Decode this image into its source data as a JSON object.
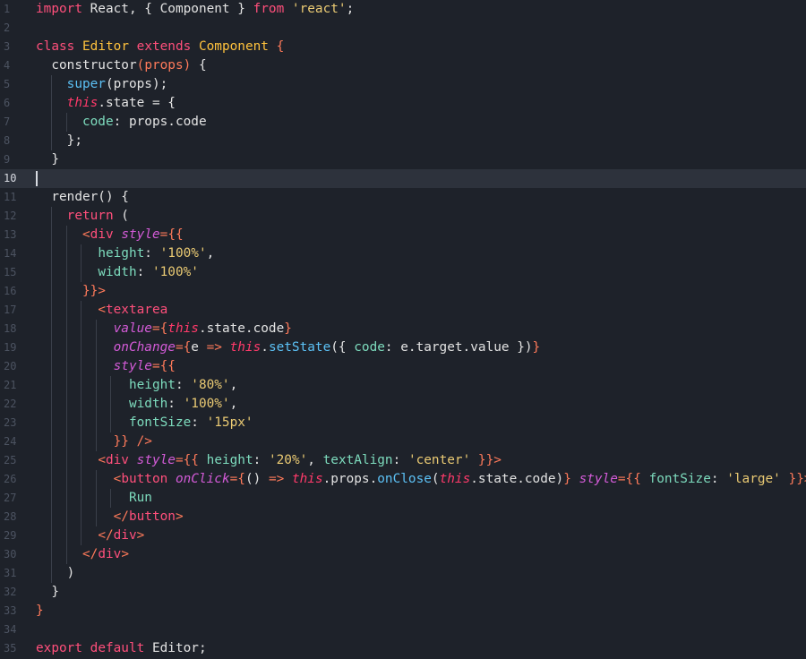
{
  "editor": {
    "current_line": 10,
    "colors": {
      "background": "#1e222a",
      "current_line_bg": "#2d323c",
      "gutter": "#4c5361",
      "text": "#e2e2e2",
      "keyword": "#ff4f7b",
      "class_name": "#ffc23d",
      "string": "#eaca73",
      "punctuation": "#ff7a5a",
      "function": "#5cc1f5",
      "property": "#7ddbbd",
      "jsx_attribute": "#d35bd7",
      "this_keyword": "#ff3a6a"
    }
  },
  "lines": [
    {
      "n": "1",
      "indent": 0,
      "tokens": [
        [
          "kw",
          "import"
        ],
        [
          "t",
          " React, { Component } "
        ],
        [
          "kw",
          "from"
        ],
        [
          "t",
          " "
        ],
        [
          "str",
          "'react'"
        ],
        [
          "t",
          ";"
        ]
      ]
    },
    {
      "n": "2",
      "indent": 0,
      "tokens": []
    },
    {
      "n": "3",
      "indent": 0,
      "tokens": [
        [
          "kw",
          "class"
        ],
        [
          "t",
          " "
        ],
        [
          "cls",
          "Editor"
        ],
        [
          "t",
          " "
        ],
        [
          "kw",
          "extends"
        ],
        [
          "t",
          " "
        ],
        [
          "cls",
          "Component"
        ],
        [
          "t",
          " "
        ],
        [
          "pun",
          "{"
        ]
      ]
    },
    {
      "n": "4",
      "indent": 1,
      "tokens": [
        [
          "t",
          "  constructor"
        ],
        [
          "pun",
          "("
        ],
        [
          "pun",
          "props"
        ],
        [
          "pun",
          ")"
        ],
        [
          "t",
          " {"
        ]
      ]
    },
    {
      "n": "5",
      "indent": 2,
      "tokens": [
        [
          "t",
          "    "
        ],
        [
          "fn",
          "super"
        ],
        [
          "t",
          "(props);"
        ]
      ]
    },
    {
      "n": "6",
      "indent": 2,
      "tokens": [
        [
          "t",
          "    "
        ],
        [
          "this",
          "this"
        ],
        [
          "t",
          ".state = {"
        ]
      ]
    },
    {
      "n": "7",
      "indent": 3,
      "tokens": [
        [
          "t",
          "      "
        ],
        [
          "prop",
          "code"
        ],
        [
          "t",
          ": props."
        ],
        [
          "t",
          "code"
        ]
      ]
    },
    {
      "n": "8",
      "indent": 2,
      "tokens": [
        [
          "t",
          "    "
        ],
        [
          "t",
          "};"
        ]
      ]
    },
    {
      "n": "9",
      "indent": 1,
      "tokens": [
        [
          "t",
          "  }"
        ]
      ]
    },
    {
      "n": "10",
      "indent": 0,
      "tokens": []
    },
    {
      "n": "11",
      "indent": 1,
      "tokens": [
        [
          "t",
          "  render() {"
        ]
      ]
    },
    {
      "n": "12",
      "indent": 2,
      "tokens": [
        [
          "t",
          "    "
        ],
        [
          "kw",
          "return"
        ],
        [
          "t",
          " ("
        ]
      ]
    },
    {
      "n": "13",
      "indent": 3,
      "tokens": [
        [
          "t",
          "      "
        ],
        [
          "pun",
          "<"
        ],
        [
          "kw",
          "div"
        ],
        [
          "t",
          " "
        ],
        [
          "attr",
          "style"
        ],
        [
          "pun",
          "={{"
        ]
      ]
    },
    {
      "n": "14",
      "indent": 4,
      "tokens": [
        [
          "t",
          "        "
        ],
        [
          "prop",
          "height"
        ],
        [
          "t",
          ": "
        ],
        [
          "str",
          "'100%'"
        ],
        [
          "t",
          ","
        ]
      ]
    },
    {
      "n": "15",
      "indent": 4,
      "tokens": [
        [
          "t",
          "        "
        ],
        [
          "prop",
          "width"
        ],
        [
          "t",
          ": "
        ],
        [
          "str",
          "'100%'"
        ]
      ]
    },
    {
      "n": "16",
      "indent": 3,
      "tokens": [
        [
          "t",
          "      "
        ],
        [
          "pun",
          "}}>"
        ]
      ]
    },
    {
      "n": "17",
      "indent": 4,
      "tokens": [
        [
          "t",
          "        "
        ],
        [
          "pun",
          "<"
        ],
        [
          "kw",
          "textarea"
        ]
      ]
    },
    {
      "n": "18",
      "indent": 5,
      "tokens": [
        [
          "t",
          "          "
        ],
        [
          "attr",
          "value"
        ],
        [
          "pun",
          "={"
        ],
        [
          "this",
          "this"
        ],
        [
          "t",
          ".state."
        ],
        [
          "t",
          "code"
        ],
        [
          "pun",
          "}"
        ]
      ]
    },
    {
      "n": "19",
      "indent": 5,
      "tokens": [
        [
          "t",
          "          "
        ],
        [
          "attr",
          "onChange"
        ],
        [
          "pun",
          "={"
        ],
        [
          "t",
          "e "
        ],
        [
          "pun",
          "=>"
        ],
        [
          "t",
          " "
        ],
        [
          "this",
          "this"
        ],
        [
          "t",
          "."
        ],
        [
          "fn",
          "setState"
        ],
        [
          "t",
          "({ "
        ],
        [
          "prop",
          "code"
        ],
        [
          "t",
          ": e.target.value })"
        ],
        [
          "pun",
          "}"
        ]
      ]
    },
    {
      "n": "20",
      "indent": 5,
      "tokens": [
        [
          "t",
          "          "
        ],
        [
          "attr",
          "style"
        ],
        [
          "pun",
          "={{"
        ]
      ]
    },
    {
      "n": "21",
      "indent": 6,
      "tokens": [
        [
          "t",
          "            "
        ],
        [
          "prop",
          "height"
        ],
        [
          "t",
          ": "
        ],
        [
          "str",
          "'80%'"
        ],
        [
          "t",
          ","
        ]
      ]
    },
    {
      "n": "22",
      "indent": 6,
      "tokens": [
        [
          "t",
          "            "
        ],
        [
          "prop",
          "width"
        ],
        [
          "t",
          ": "
        ],
        [
          "str",
          "'100%'"
        ],
        [
          "t",
          ","
        ]
      ]
    },
    {
      "n": "23",
      "indent": 6,
      "tokens": [
        [
          "t",
          "            "
        ],
        [
          "prop",
          "fontSize"
        ],
        [
          "t",
          ": "
        ],
        [
          "str",
          "'15px'"
        ]
      ]
    },
    {
      "n": "24",
      "indent": 5,
      "tokens": [
        [
          "t",
          "          "
        ],
        [
          "pun",
          "}}"
        ],
        [
          "t",
          " "
        ],
        [
          "pun",
          "/>"
        ]
      ]
    },
    {
      "n": "25",
      "indent": 4,
      "tokens": [
        [
          "t",
          "        "
        ],
        [
          "pun",
          "<"
        ],
        [
          "kw",
          "div"
        ],
        [
          "t",
          " "
        ],
        [
          "attr",
          "style"
        ],
        [
          "pun",
          "={{"
        ],
        [
          "t",
          " "
        ],
        [
          "prop",
          "height"
        ],
        [
          "t",
          ": "
        ],
        [
          "str",
          "'20%'"
        ],
        [
          "t",
          ", "
        ],
        [
          "prop",
          "textAlign"
        ],
        [
          "t",
          ": "
        ],
        [
          "str",
          "'center'"
        ],
        [
          "t",
          " "
        ],
        [
          "pun",
          "}}>"
        ]
      ]
    },
    {
      "n": "26",
      "indent": 5,
      "tokens": [
        [
          "t",
          "          "
        ],
        [
          "pun",
          "<"
        ],
        [
          "kw",
          "button"
        ],
        [
          "t",
          " "
        ],
        [
          "attr",
          "onClick"
        ],
        [
          "pun",
          "={"
        ],
        [
          "t",
          "() "
        ],
        [
          "pun",
          "=>"
        ],
        [
          "t",
          " "
        ],
        [
          "this",
          "this"
        ],
        [
          "t",
          ".props."
        ],
        [
          "fn",
          "onClose"
        ],
        [
          "t",
          "("
        ],
        [
          "this",
          "this"
        ],
        [
          "t",
          ".state.code)"
        ],
        [
          "pun",
          "}"
        ],
        [
          "t",
          " "
        ],
        [
          "attr",
          "style"
        ],
        [
          "pun",
          "={{"
        ],
        [
          "t",
          " "
        ],
        [
          "prop",
          "fontSize"
        ],
        [
          "t",
          ": "
        ],
        [
          "str",
          "'large'"
        ],
        [
          "t",
          " "
        ],
        [
          "pun",
          "}}>"
        ]
      ]
    },
    {
      "n": "27",
      "indent": 6,
      "tokens": [
        [
          "t",
          "            "
        ],
        [
          "prop",
          "Run"
        ]
      ]
    },
    {
      "n": "28",
      "indent": 5,
      "tokens": [
        [
          "t",
          "          "
        ],
        [
          "pun",
          "</"
        ],
        [
          "kw",
          "button"
        ],
        [
          "pun",
          ">"
        ]
      ]
    },
    {
      "n": "29",
      "indent": 4,
      "tokens": [
        [
          "t",
          "        "
        ],
        [
          "pun",
          "</"
        ],
        [
          "kw",
          "div"
        ],
        [
          "pun",
          ">"
        ]
      ]
    },
    {
      "n": "30",
      "indent": 3,
      "tokens": [
        [
          "t",
          "      "
        ],
        [
          "pun",
          "</"
        ],
        [
          "kw",
          "div"
        ],
        [
          "pun",
          ">"
        ]
      ]
    },
    {
      "n": "31",
      "indent": 2,
      "tokens": [
        [
          "t",
          "    )"
        ]
      ]
    },
    {
      "n": "32",
      "indent": 1,
      "tokens": [
        [
          "t",
          "  }"
        ]
      ]
    },
    {
      "n": "33",
      "indent": 0,
      "tokens": [
        [
          "pun",
          "}"
        ]
      ]
    },
    {
      "n": "34",
      "indent": 0,
      "tokens": []
    },
    {
      "n": "35",
      "indent": 0,
      "tokens": [
        [
          "kw",
          "export"
        ],
        [
          "t",
          " "
        ],
        [
          "kw",
          "default"
        ],
        [
          "t",
          " Editor;"
        ]
      ]
    }
  ]
}
